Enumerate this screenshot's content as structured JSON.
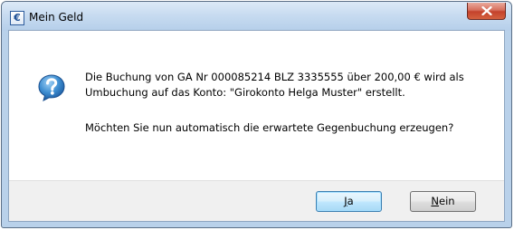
{
  "window": {
    "title": "Mein Geld",
    "app_icon_glyph": "€",
    "close_icon": "close-icon"
  },
  "message": {
    "icon": "question-icon",
    "line1": "Die Buchung von GA Nr 000085214 BLZ 3335555 über 200,00 € wird als",
    "line2": "Umbuchung auf das Konto: \"Girokonto Helga Muster\" erstellt.",
    "line3": "Möchten Sie nun automatisch die erwartete Gegenbuchung erzeugen?"
  },
  "buttons": {
    "yes_mnemonic": "J",
    "yes_rest": "a",
    "no_mnemonic": "N",
    "no_rest": "ein"
  },
  "colors": {
    "titlebar": "#c6daf0",
    "close_button": "#c4422c",
    "default_button_border": "#3c7fb1"
  }
}
